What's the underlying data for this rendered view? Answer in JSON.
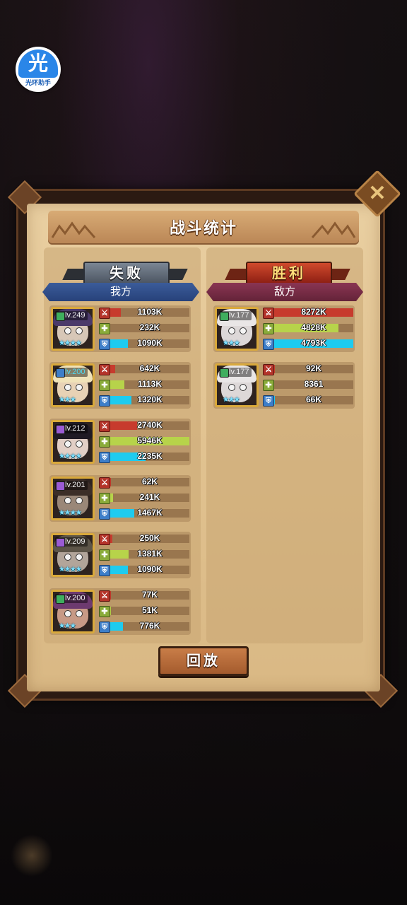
{
  "helper": {
    "icon_text": "光",
    "label": "光环助手"
  },
  "dialog": {
    "title": "战斗统计",
    "close_icon": "close-icon",
    "replay_label": "回放"
  },
  "left": {
    "result": "失败",
    "side": "我方",
    "heroes": [
      {
        "level": "lv.249",
        "level_color": "white",
        "class_color": "#3fae5e",
        "stars": "★★★★",
        "skin": "#d7c7b7",
        "hair": "#4b3a6a",
        "damage": "1103K",
        "damage_pct": 0.13,
        "heal": "232K",
        "heal_pct": 0.0,
        "defense": "1090K",
        "defense_pct": 0.22
      },
      {
        "level": "lv.200",
        "level_color": "cyan",
        "class_color": "#3d7ec9",
        "stars": "★★★",
        "skin": "#e8d2b5",
        "hair": "#f0e2b8",
        "damage": "642K",
        "damage_pct": 0.06,
        "heal": "1113K",
        "heal_pct": 0.18,
        "defense": "1320K",
        "defense_pct": 0.27
      },
      {
        "level": "lv.212",
        "level_color": "white",
        "class_color": "#9b5bd4",
        "stars": "★★★★",
        "skin": "#e2cfc6",
        "hair": "#1f1a24",
        "damage": "2740K",
        "damage_pct": 0.34,
        "heal": "5946K",
        "heal_pct": 1.0,
        "defense": "2235K",
        "defense_pct": 0.45
      },
      {
        "level": "lv.201",
        "level_color": "white",
        "class_color": "#9b5bd4",
        "stars": "★★★★",
        "skin": "#9a8778",
        "hair": "#3c2e28",
        "damage": "62K",
        "damage_pct": 0.01,
        "heal": "241K",
        "heal_pct": 0.04,
        "defense": "1467K",
        "defense_pct": 0.3
      },
      {
        "level": "lv.209",
        "level_color": "white",
        "class_color": "#9b5bd4",
        "stars": "★★★★",
        "skin": "#b2a59a",
        "hair": "#5d5548",
        "damage": "250K",
        "damage_pct": 0.03,
        "heal": "1381K",
        "heal_pct": 0.23,
        "defense": "1090K",
        "defense_pct": 0.22
      },
      {
        "level": "lv.200",
        "level_color": "white",
        "class_color": "#3fae5e",
        "stars": "★★★",
        "skin": "#c79a86",
        "hair": "#6d3a6f",
        "damage": "77K",
        "damage_pct": 0.01,
        "heal": "51K",
        "heal_pct": 0.01,
        "defense": "776K",
        "defense_pct": 0.16
      }
    ]
  },
  "right": {
    "result": "胜利",
    "side": "敌方",
    "heroes": [
      {
        "level": "lv.177",
        "level_color": "white",
        "class_color": "#3fae5e",
        "stars": "★★★",
        "skin": "#ddd8d8",
        "hair": "#e9e6e6",
        "damage": "8272K",
        "damage_pct": 1.0,
        "heal": "4828K",
        "heal_pct": 0.81,
        "defense": "4793K",
        "defense_pct": 1.0
      },
      {
        "level": "lv.177",
        "level_color": "white",
        "class_color": "#3fae5e",
        "stars": "★★★",
        "skin": "#ddd8d8",
        "hair": "#e9e6e6",
        "damage": "92K",
        "damage_pct": 0.01,
        "heal": "8361",
        "heal_pct": 0.0,
        "defense": "66K",
        "defense_pct": 0.01
      }
    ]
  },
  "colors": {
    "damage": "#c73b2d",
    "heal": "#b7d34a",
    "defense": "#1ecbef"
  }
}
